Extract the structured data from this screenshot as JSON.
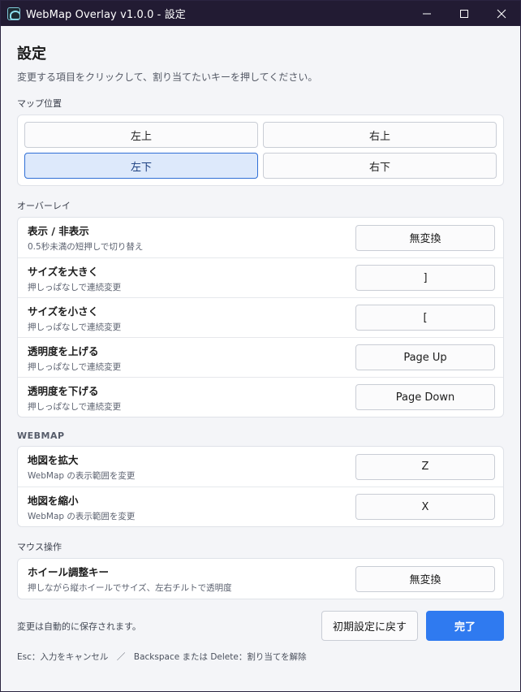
{
  "window": {
    "title": "WebMap Overlay v1.0.0 - 設定",
    "minimize_icon": "minimize-icon",
    "maximize_icon": "maximize-icon",
    "close_icon": "close-icon"
  },
  "header": {
    "title": "設定",
    "description": "変更する項目をクリックして、割り当てたいキーを押してください。"
  },
  "map_position": {
    "label": "マップ位置",
    "options": [
      {
        "label": "左上",
        "selected": false
      },
      {
        "label": "右上",
        "selected": false
      },
      {
        "label": "左下",
        "selected": true
      },
      {
        "label": "右下",
        "selected": false
      }
    ]
  },
  "overlay": {
    "label": "オーバーレイ",
    "rows": [
      {
        "title": "表示 / 非表示",
        "sub": "0.5秒未満の短押しで切り替え",
        "key": "無変換"
      },
      {
        "title": "サイズを大きく",
        "sub": "押しっぱなしで連続変更",
        "key": "]"
      },
      {
        "title": "サイズを小さく",
        "sub": "押しっぱなしで連続変更",
        "key": "["
      },
      {
        "title": "透明度を上げる",
        "sub": "押しっぱなしで連続変更",
        "key": "Page Up"
      },
      {
        "title": "透明度を下げる",
        "sub": "押しっぱなしで連続変更",
        "key": "Page Down"
      }
    ]
  },
  "webmap": {
    "label": "WEBMAP",
    "rows": [
      {
        "title": "地図を拡大",
        "sub": "WebMap の表示範囲を変更",
        "key": "Z"
      },
      {
        "title": "地図を縮小",
        "sub": "WebMap の表示範囲を変更",
        "key": "X"
      }
    ]
  },
  "mouse": {
    "label": "マウス操作",
    "rows": [
      {
        "title": "ホイール調整キー",
        "sub": "押しながら縦ホイールでサイズ、左右チルトで透明度",
        "key": "無変換"
      }
    ]
  },
  "footer": {
    "autosave": "変更は自動的に保存されます。",
    "reset_label": "初期設定に戻す",
    "done_label": "完了",
    "hint": "Esc：入力をキャンセル　／　Backspace または Delete：割り当てを解除"
  },
  "colors": {
    "titlebar": "#221b33",
    "accent": "#2f7af0",
    "selected_bg": "#dde9fb"
  }
}
